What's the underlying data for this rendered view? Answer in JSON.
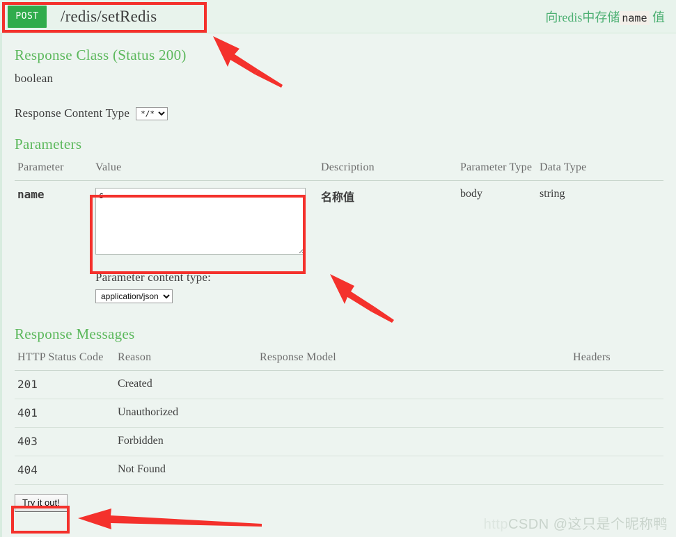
{
  "operation": {
    "method": "POST",
    "path": "/redis/setRedis",
    "summary_prefix": "向redis中存储",
    "summary_code": "name",
    "summary_suffix": "值"
  },
  "response_class": {
    "title": "Response Class (Status 200)",
    "model": "boolean",
    "content_type_label": "Response Content Type",
    "content_type_value": "*/*"
  },
  "parameters": {
    "title": "Parameters",
    "headers": {
      "parameter": "Parameter",
      "value": "Value",
      "description": "Description",
      "parameter_type": "Parameter Type",
      "data_type": "Data Type"
    },
    "rows": [
      {
        "name": "name",
        "value": "s",
        "description": "名称值",
        "parameter_type": "body",
        "data_type": "string"
      }
    ],
    "content_type_label": "Parameter content type:",
    "content_type_value": "application/json"
  },
  "response_messages": {
    "title": "Response Messages",
    "headers": {
      "status_code": "HTTP Status Code",
      "reason": "Reason",
      "response_model": "Response Model",
      "headers": "Headers"
    },
    "rows": [
      {
        "code": "201",
        "reason": "Created",
        "model": "",
        "headers": ""
      },
      {
        "code": "401",
        "reason": "Unauthorized",
        "model": "",
        "headers": ""
      },
      {
        "code": "403",
        "reason": "Forbidden",
        "model": "",
        "headers": ""
      },
      {
        "code": "404",
        "reason": "Not Found",
        "model": "",
        "headers": ""
      }
    ]
  },
  "actions": {
    "try_it_out": "Try it out!"
  },
  "watermark": {
    "faint": "http",
    "text": "CSDN @这只是个昵称鸭"
  },
  "colors": {
    "method_badge": "#30ac4c",
    "section_heading": "#5cb85c",
    "panel_background": "#edf4f0",
    "header_background": "#e8f3ec",
    "annotation": "#f4312c"
  }
}
